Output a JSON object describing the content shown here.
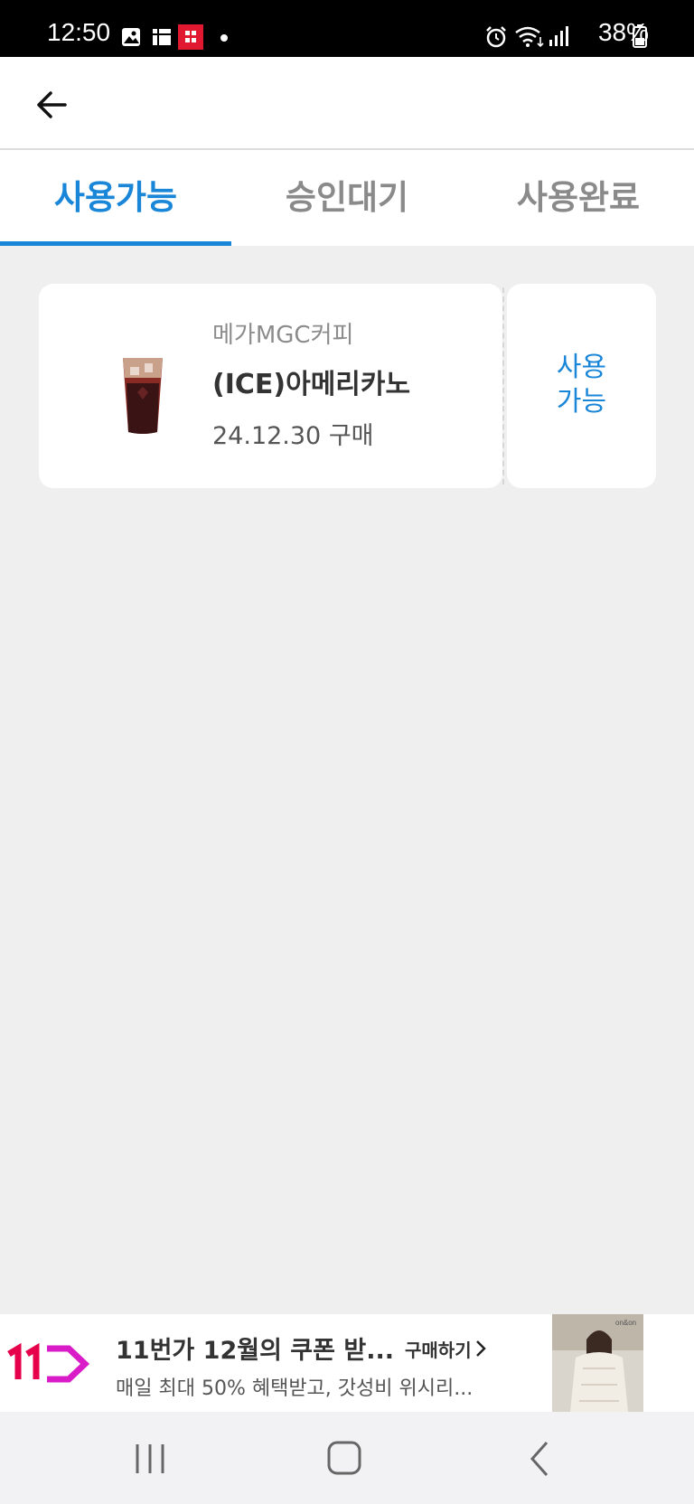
{
  "status_bar": {
    "time": "12:50",
    "battery": "38%",
    "icons": [
      "gallery-icon",
      "list-icon",
      "app-notification-icon",
      "notification-dot-icon",
      "alarm-icon",
      "wifi-icon",
      "signal-icon",
      "battery-icon"
    ]
  },
  "app_bar": {
    "back_icon": "back-arrow-icon"
  },
  "tabs": [
    {
      "label": "사용가능",
      "active": true
    },
    {
      "label": "승인대기",
      "active": false
    },
    {
      "label": "사용완료",
      "active": false
    }
  ],
  "coupon": {
    "brand": "메가MGC커피",
    "product": "(ICE)아메리카노",
    "purchase_date": "24.12.30 구매",
    "status_line1": "사용",
    "status_line2": "가능",
    "image_icon": "iced-coffee-icon"
  },
  "ad": {
    "logo": "11st-logo",
    "title": "11번가 12월의 쿠폰 받...",
    "cta": "구매하기",
    "subtitle": "매일 최대 50% 혜택받고, 갓성비 위시리...",
    "image": "winter-coat-model-image"
  },
  "nav_bar": {
    "icons": [
      "recent-apps-icon",
      "home-icon",
      "back-icon"
    ]
  },
  "colors": {
    "accent": "#1a86d8",
    "background": "#efefef",
    "ad_logo": "#e6004c"
  }
}
